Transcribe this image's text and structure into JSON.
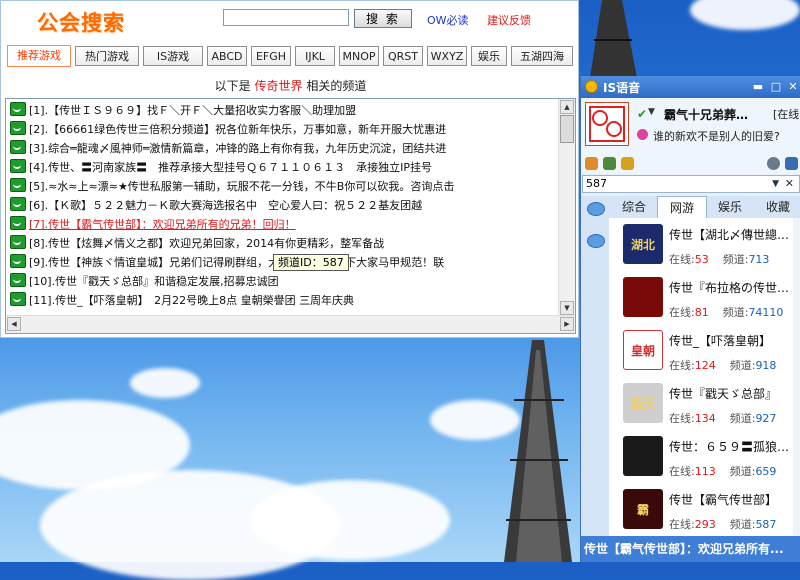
{
  "search_window": {
    "logo": "公会搜索",
    "search_input": {
      "value": ""
    },
    "search_button": "搜 索",
    "links": {
      "ow": "OW必读",
      "feedback": "建议反馈"
    },
    "tabs": [
      {
        "label": "推荐游戏",
        "active": true
      },
      {
        "label": "热门游戏"
      },
      {
        "label": "IS游戏"
      },
      {
        "label": "ABCD"
      },
      {
        "label": "EFGH"
      },
      {
        "label": "IJKL"
      },
      {
        "label": "MNOP"
      },
      {
        "label": "QRST"
      },
      {
        "label": "WXYZ"
      },
      {
        "label": "娱乐"
      },
      {
        "label": "五湖四海"
      }
    ],
    "subtitle": {
      "prefix": "以下是",
      "game": "传奇世界",
      "suffix": "相关的频道"
    },
    "channels": [
      "[1].【传世ＩＳ９６９】找Ｆ＼开Ｆ＼大量招收实力客服＼助理加盟",
      "[2].【66661绿色传世三倍积分频道】祝各位新年快乐，万事如意，新年开服大忧惠进",
      "[3].综合═龍魂〆風神师═激情新篇章，冲锋的路上有你有我，九年历史沉淀，团结共进",
      "[4].传世、〓河南家族〓　推荐承接大型挂号Ｑ６７１１０６１３　承接独立IP挂号",
      "[5].≈水≈上≈漂≈★传世私服第一辅助，玩服不花一分钱，不牛B你可以砍我。咨询点击",
      "[6].【Ｋ歌】５２２魅力－Ｋ歌大赛海选报名中　空心爱人曰：祝５２２基友团越",
      "[7].传世【霸气传世部】：欢迎兄弟所有的兄弟！回归！",
      "[8].传世【炫舞〆情义之都】欢迎兄弟回家，2014有你更精彩，整军备战",
      "[9].传世【神族ヾ情谊皇城】兄弟们记得刷群组，大家好，请注意下大家马甲规范！联",
      "[10].传世『戳天ゞ总部』和谐稳定发展,招募忠诚团",
      "[11].传世_【吓落皇朝】　2月22号晚上8点 皇朝榮譽团 三周年庆典"
    ],
    "tooltip": "频道ID：587"
  },
  "is_window": {
    "title": "IS语音",
    "window_buttons": {
      "minimize": "▬",
      "maximize": "□",
      "close": "✕"
    },
    "profile": {
      "nickname": "霸气十兄弟葬…",
      "status": "[在线",
      "signature": "谁的新欢不是别人的旧爱?"
    },
    "search_value": "587",
    "tabs": [
      {
        "label": "综合"
      },
      {
        "label": "网游",
        "active": true
      },
      {
        "label": "娱乐"
      },
      {
        "label": "收藏"
      }
    ],
    "channels": [
      {
        "name": "传世【湖北〆傳世總…",
        "online_label": "在线:",
        "online": "53",
        "id_label": "频道:",
        "id": "713",
        "avatar_color": "#1b2a6b",
        "avatar_text": "湖北"
      },
      {
        "name": "传世『布拉格の传世…",
        "online_label": "在线:",
        "online": "81",
        "id_label": "频道:",
        "id": "74110",
        "avatar_color": "#7a0a0a",
        "avatar_text": ""
      },
      {
        "name": "传世_【吓落皇朝】",
        "online_label": "在线:",
        "online": "124",
        "id_label": "频道:",
        "id": "918",
        "avatar_color": "#ffffff",
        "avatar_text": "皇朝"
      },
      {
        "name": "传世『戳天ゞ总部』",
        "online_label": "在线:",
        "online": "134",
        "id_label": "频道:",
        "id": "927",
        "avatar_color": "#cfcfcf",
        "avatar_text": "戳天"
      },
      {
        "name": "传世：６５９〓孤狼…",
        "online_label": "在线:",
        "online": "113",
        "id_label": "频道:",
        "id": "659",
        "avatar_color": "#1a1a1a",
        "avatar_text": ""
      },
      {
        "name": "传世【霸气传世部】",
        "online_label": "在线:",
        "online": "293",
        "id_label": "频道:",
        "id": "587",
        "avatar_color": "#3a0a0a",
        "avatar_text": "霸"
      }
    ],
    "footer": "传世【霸气传世部】：欢迎兄弟所有..."
  }
}
